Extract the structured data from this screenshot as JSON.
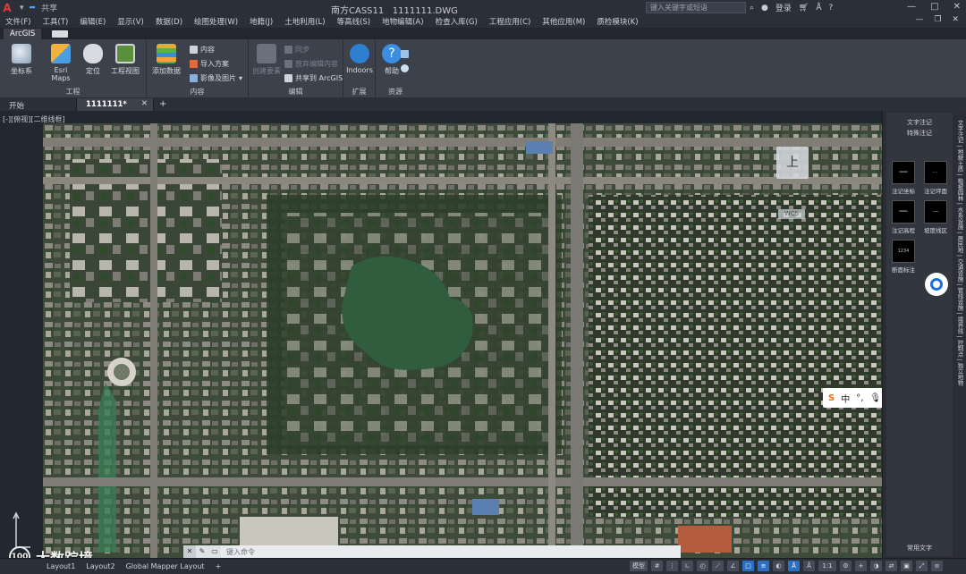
{
  "titlebar": {
    "share": "共享",
    "app_title": "南方CASS11",
    "file_name": "1111111.DWG",
    "search_placeholder": "键入关键字或短语",
    "login": "登录"
  },
  "menu": [
    "文件(F)",
    "工具(T)",
    "编辑(E)",
    "显示(V)",
    "数据(D)",
    "绘图处理(W)",
    "地籍(J)",
    "土地利用(L)",
    "等高线(S)",
    "地物编辑(A)",
    "检查入库(G)",
    "工程应用(C)",
    "其他应用(M)",
    "质检模块(K)"
  ],
  "ribbon_tabs": {
    "active": "ArcGIS"
  },
  "ribbon": {
    "groups": [
      {
        "label": "工程",
        "buttons": [
          "坐标系",
          "Esri Maps",
          "定位",
          "工程视图"
        ]
      },
      {
        "label": "内容",
        "big": "添加数据",
        "small": [
          "内容",
          "导入方案",
          "影像及图片"
        ]
      },
      {
        "label": "编辑",
        "big": "创建要素",
        "small": [
          "同步",
          "放弃编辑内容",
          "共享到 ArcGIS"
        ]
      },
      {
        "label": "扩展",
        "big": "Indoors"
      },
      {
        "label": "资源",
        "big": "帮助"
      }
    ]
  },
  "doc_tabs": {
    "start": "开始",
    "file": "1111111*"
  },
  "viewport": {
    "label": "[-][俯视][二维线框]",
    "compass": "上",
    "badge": "WCS"
  },
  "command": {
    "placeholder": "键入命令"
  },
  "ime": {
    "lang": "中"
  },
  "right_panel": {
    "title": "文字注记",
    "subtitle": "特殊注记",
    "symbols": [
      "注记坐标",
      "注记坪面",
      "注记高程",
      "坡度线区",
      "断面标注"
    ],
    "symbol_box_text": "1234",
    "bottom": "常用文字",
    "vtabs": "文字注记 | 地貌土质 | 植被园林 | 水系设施 | 居民地 | 交通设施 | 管线设施 | 境界线 | 控制点 | 独立地物"
  },
  "layouts": [
    "Layout1",
    "Layout2",
    "Global Mapper Layout"
  ],
  "watermark": {
    "text": "大数踪境",
    "circle": "100"
  },
  "status": {
    "scale": "1:1",
    "model": "模型"
  }
}
